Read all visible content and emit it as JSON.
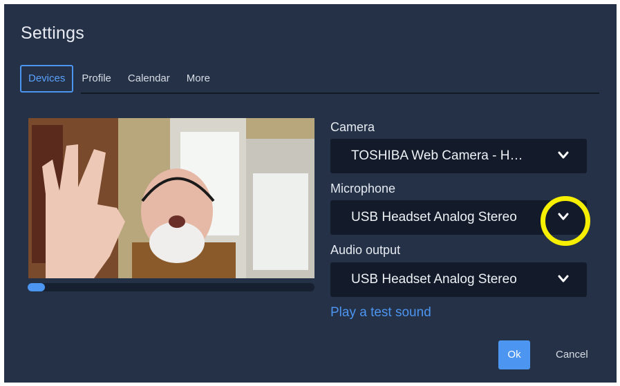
{
  "dialog": {
    "title": "Settings",
    "tabs": [
      {
        "label": "Devices",
        "active": true
      },
      {
        "label": "Profile",
        "active": false
      },
      {
        "label": "Calendar",
        "active": false
      },
      {
        "label": "More",
        "active": false
      }
    ]
  },
  "preview": {
    "audio_level": 0.06
  },
  "devices": {
    "camera": {
      "label": "Camera",
      "value": "TOSHIBA Web Camera - H…"
    },
    "microphone": {
      "label": "Microphone",
      "value": "USB Headset Analog Stereo"
    },
    "audio_output": {
      "label": "Audio output",
      "value": "USB Headset Analog Stereo"
    },
    "test_sound": "Play a test sound"
  },
  "actions": {
    "ok": "Ok",
    "cancel": "Cancel"
  },
  "colors": {
    "accent": "#4c95f0",
    "background": "#253147",
    "highlight": "#f6f000"
  }
}
